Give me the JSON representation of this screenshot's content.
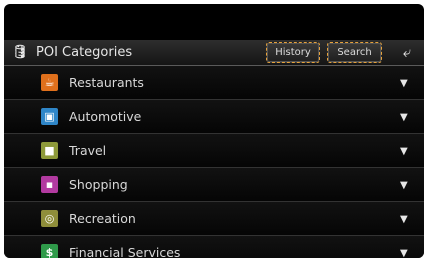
{
  "header": {
    "title": "POI Categories",
    "history_label": "History",
    "search_label": "Search",
    "back_icon": "back-arrow-icon"
  },
  "categories": [
    {
      "label": "Restaurants",
      "icon": "restaurant-icon",
      "color": "#e0701c",
      "glyph": "☕"
    },
    {
      "label": "Automotive",
      "icon": "car-icon",
      "color": "#2f86c8",
      "glyph": "▣"
    },
    {
      "label": "Travel",
      "icon": "travel-icon",
      "color": "#8e9a3a",
      "glyph": "■"
    },
    {
      "label": "Shopping",
      "icon": "shopping-icon",
      "color": "#b23aa0",
      "glyph": "▪"
    },
    {
      "label": "Recreation",
      "icon": "recreation-icon",
      "color": "#8f8e3a",
      "glyph": "◎"
    },
    {
      "label": "Financial Services",
      "icon": "money-icon",
      "color": "#2f9a4a",
      "glyph": "$"
    }
  ]
}
